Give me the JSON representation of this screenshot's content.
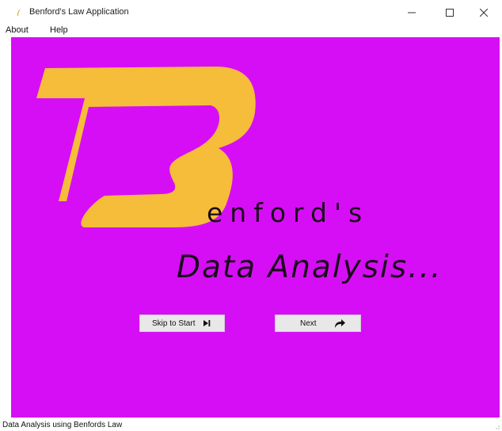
{
  "window": {
    "title": "Benford's Law Application",
    "app_icon": "feather-icon",
    "controls": [
      "minimize-icon",
      "maximize-icon",
      "close-icon"
    ]
  },
  "menu": {
    "items": [
      {
        "label": "About"
      },
      {
        "label": "Help"
      }
    ]
  },
  "splash": {
    "logo_letter": "B",
    "enford_text": "enford's",
    "tagline": "Data Analysis...",
    "background_color": "#d60ef5",
    "logo_color": "#f5bd3a"
  },
  "buttons": {
    "skip_label": "Skip to Start",
    "skip_icon": "skip-to-end-icon",
    "next_label": "Next",
    "next_icon": "redo-arrow-icon"
  },
  "status": {
    "text": "Data Analysis using Benfords Law"
  }
}
